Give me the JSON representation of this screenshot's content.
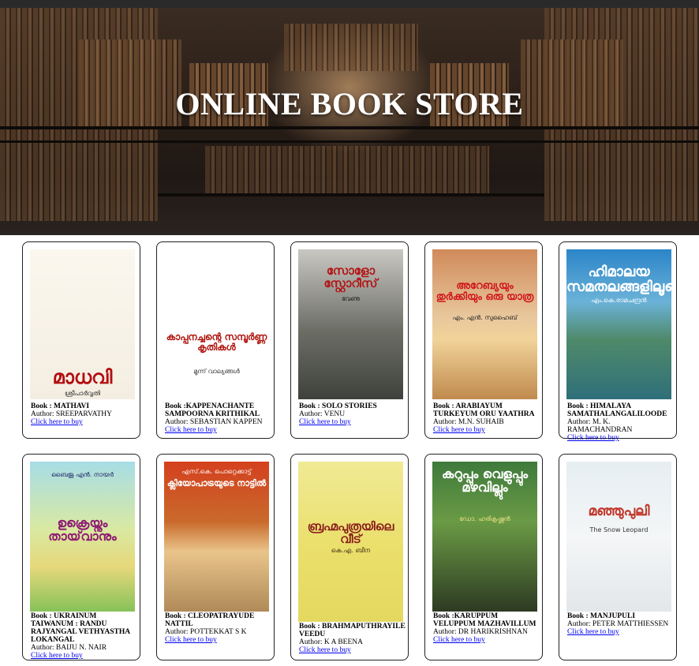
{
  "header": {
    "title": "ONLINE BOOK STORE"
  },
  "link_text": "Click here to buy",
  "books": [
    {
      "book": "Book : MATHAVI",
      "author": "Author: SREEPARVATHY",
      "cover_title": "മാധവി",
      "cover_author": "ശ്രീപാർവ്വതി"
    },
    {
      "book": "Book :KAPPENACHANTE SAMPOORNA KRITHIKAL",
      "author": "Author: SEBASTIAN KAPPEN",
      "cover_title": "കാപ്പനച്ചന്റെ സമ്പൂർണ്ണ കൃതികൾ",
      "cover_author": "മൂന്ന് വാല്യങ്ങൾ"
    },
    {
      "book": "Book : SOLO STORIES",
      "author": "Author: VENU",
      "cover_title": "സോളോ സ്റ്റോറീസ്",
      "cover_author": "വേണു"
    },
    {
      "book": "Book : ARABIAYUM TURKEYUM ORU YAATHRA",
      "author": "Author: M.N. SUHAIB",
      "cover_title": "അറേബ്യയും തുർക്കിയും ഒരു യാത്ര",
      "cover_author": "എം. എൻ. സുഹൈബ്"
    },
    {
      "book": "Book : HIMALAYA SAMATHALANGALILOODE",
      "author": "Author: M. K. RAMACHANDRAN",
      "cover_title": "ഹിമാലയ സമതലങ്ങളിലൂടെ",
      "cover_author": "എം.കെ.രാമചന്ദ്രൻ"
    },
    {
      "book": "Book : UKRAINUM TAIWANUM : RANDU RAJYANGAL VETHYASTHA LOKANGAL",
      "author": "Author: BAIJU N. NAIR",
      "cover_title": "ഉക്രെയ്നും തായ്‌വാനും",
      "cover_author": "ബൈജു എൻ. നായർ"
    },
    {
      "book": "Book : CLEOPATRAYUDE NATTIL",
      "author": "Author: POTTEKKAT S K",
      "cover_title": "ക്ലിയോപാട്രയുടെ നാട്ടിൽ",
      "cover_author": "എസ്.കെ. പൊറ്റെക്കാട്ട്"
    },
    {
      "book": "Book : BRAHMAPUTHRAYILE VEEDU",
      "author": "Author: K A BEENA",
      "cover_title": "ബ്രഹ്മപുത്രയിലെ വീട്",
      "cover_author": "കെ.എ. ബീന"
    },
    {
      "book": "Book :KARUPPUM VELUPPUM MAZHAVILLUM",
      "author": "Author: DR HARIKRISHNAN",
      "cover_title": "കറുപ്പും വെളുപ്പും മഴവില്ലും",
      "cover_author": "ഡോ. ഹരികൃഷ്ണൻ"
    },
    {
      "book": "Book : MANJUPULI",
      "author": "Author: PETER MATTHIESSEN",
      "cover_title": "മഞ്ഞുപുലി",
      "cover_author": "The Snow Leopard"
    }
  ],
  "colors": {
    "card_border": "#222222",
    "link": "#0000ee",
    "hero_title": "#ffffff"
  }
}
